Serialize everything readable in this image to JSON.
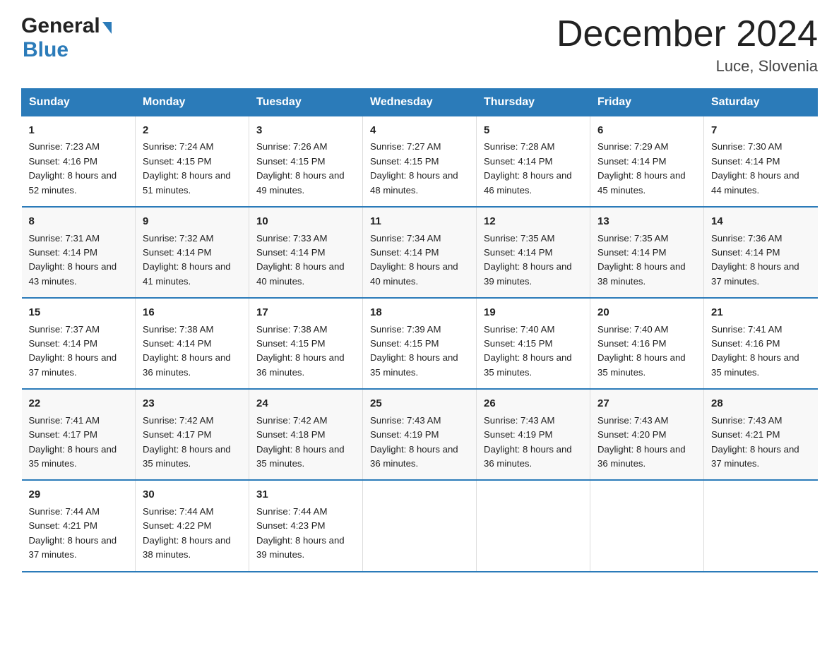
{
  "logo": {
    "line1": "General",
    "arrow": "▶",
    "line2": "Blue"
  },
  "title": "December 2024",
  "subtitle": "Luce, Slovenia",
  "days_header": [
    "Sunday",
    "Monday",
    "Tuesday",
    "Wednesday",
    "Thursday",
    "Friday",
    "Saturday"
  ],
  "weeks": [
    [
      {
        "num": "1",
        "sunrise": "7:23 AM",
        "sunset": "4:16 PM",
        "daylight": "8 hours and 52 minutes."
      },
      {
        "num": "2",
        "sunrise": "7:24 AM",
        "sunset": "4:15 PM",
        "daylight": "8 hours and 51 minutes."
      },
      {
        "num": "3",
        "sunrise": "7:26 AM",
        "sunset": "4:15 PM",
        "daylight": "8 hours and 49 minutes."
      },
      {
        "num": "4",
        "sunrise": "7:27 AM",
        "sunset": "4:15 PM",
        "daylight": "8 hours and 48 minutes."
      },
      {
        "num": "5",
        "sunrise": "7:28 AM",
        "sunset": "4:14 PM",
        "daylight": "8 hours and 46 minutes."
      },
      {
        "num": "6",
        "sunrise": "7:29 AM",
        "sunset": "4:14 PM",
        "daylight": "8 hours and 45 minutes."
      },
      {
        "num": "7",
        "sunrise": "7:30 AM",
        "sunset": "4:14 PM",
        "daylight": "8 hours and 44 minutes."
      }
    ],
    [
      {
        "num": "8",
        "sunrise": "7:31 AM",
        "sunset": "4:14 PM",
        "daylight": "8 hours and 43 minutes."
      },
      {
        "num": "9",
        "sunrise": "7:32 AM",
        "sunset": "4:14 PM",
        "daylight": "8 hours and 41 minutes."
      },
      {
        "num": "10",
        "sunrise": "7:33 AM",
        "sunset": "4:14 PM",
        "daylight": "8 hours and 40 minutes."
      },
      {
        "num": "11",
        "sunrise": "7:34 AM",
        "sunset": "4:14 PM",
        "daylight": "8 hours and 40 minutes."
      },
      {
        "num": "12",
        "sunrise": "7:35 AM",
        "sunset": "4:14 PM",
        "daylight": "8 hours and 39 minutes."
      },
      {
        "num": "13",
        "sunrise": "7:35 AM",
        "sunset": "4:14 PM",
        "daylight": "8 hours and 38 minutes."
      },
      {
        "num": "14",
        "sunrise": "7:36 AM",
        "sunset": "4:14 PM",
        "daylight": "8 hours and 37 minutes."
      }
    ],
    [
      {
        "num": "15",
        "sunrise": "7:37 AM",
        "sunset": "4:14 PM",
        "daylight": "8 hours and 37 minutes."
      },
      {
        "num": "16",
        "sunrise": "7:38 AM",
        "sunset": "4:14 PM",
        "daylight": "8 hours and 36 minutes."
      },
      {
        "num": "17",
        "sunrise": "7:38 AM",
        "sunset": "4:15 PM",
        "daylight": "8 hours and 36 minutes."
      },
      {
        "num": "18",
        "sunrise": "7:39 AM",
        "sunset": "4:15 PM",
        "daylight": "8 hours and 35 minutes."
      },
      {
        "num": "19",
        "sunrise": "7:40 AM",
        "sunset": "4:15 PM",
        "daylight": "8 hours and 35 minutes."
      },
      {
        "num": "20",
        "sunrise": "7:40 AM",
        "sunset": "4:16 PM",
        "daylight": "8 hours and 35 minutes."
      },
      {
        "num": "21",
        "sunrise": "7:41 AM",
        "sunset": "4:16 PM",
        "daylight": "8 hours and 35 minutes."
      }
    ],
    [
      {
        "num": "22",
        "sunrise": "7:41 AM",
        "sunset": "4:17 PM",
        "daylight": "8 hours and 35 minutes."
      },
      {
        "num": "23",
        "sunrise": "7:42 AM",
        "sunset": "4:17 PM",
        "daylight": "8 hours and 35 minutes."
      },
      {
        "num": "24",
        "sunrise": "7:42 AM",
        "sunset": "4:18 PM",
        "daylight": "8 hours and 35 minutes."
      },
      {
        "num": "25",
        "sunrise": "7:43 AM",
        "sunset": "4:19 PM",
        "daylight": "8 hours and 36 minutes."
      },
      {
        "num": "26",
        "sunrise": "7:43 AM",
        "sunset": "4:19 PM",
        "daylight": "8 hours and 36 minutes."
      },
      {
        "num": "27",
        "sunrise": "7:43 AM",
        "sunset": "4:20 PM",
        "daylight": "8 hours and 36 minutes."
      },
      {
        "num": "28",
        "sunrise": "7:43 AM",
        "sunset": "4:21 PM",
        "daylight": "8 hours and 37 minutes."
      }
    ],
    [
      {
        "num": "29",
        "sunrise": "7:44 AM",
        "sunset": "4:21 PM",
        "daylight": "8 hours and 37 minutes."
      },
      {
        "num": "30",
        "sunrise": "7:44 AM",
        "sunset": "4:22 PM",
        "daylight": "8 hours and 38 minutes."
      },
      {
        "num": "31",
        "sunrise": "7:44 AM",
        "sunset": "4:23 PM",
        "daylight": "8 hours and 39 minutes."
      },
      null,
      null,
      null,
      null
    ]
  ]
}
